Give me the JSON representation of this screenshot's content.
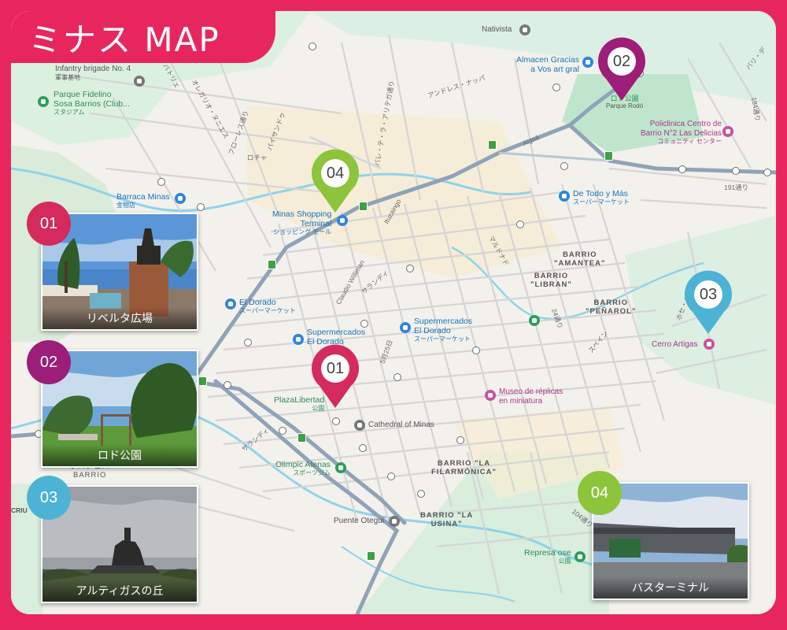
{
  "title": "ミナス MAP",
  "colors": {
    "brand": "#e8265e",
    "pin1": "#d42a5e",
    "pin2": "#9c1e78",
    "pin3": "#4cb3d4",
    "pin4": "#8cc43c"
  },
  "pins": [
    {
      "num": "01"
    },
    {
      "num": "02"
    },
    {
      "num": "03"
    },
    {
      "num": "04"
    }
  ],
  "photos": [
    {
      "num": "01",
      "caption": "リベルタ広場"
    },
    {
      "num": "02",
      "caption": "ロド公園"
    },
    {
      "num": "03",
      "caption": "アルティガスの丘"
    },
    {
      "num": "04",
      "caption": "バスターミナル"
    }
  ],
  "map_labels": {
    "nativista": "Nativista",
    "almacen": "Almacen Gracias",
    "almacen2": "a Vos art gral",
    "infantry": "Infantry brigade No. 4",
    "infantry_sub": "軍事基地",
    "parque_fidelino": "Parque Fidelino",
    "parque_fidelino2": "Sosa Barrios (Club...",
    "parque_fidelino_sub": "スタジアム",
    "parque_rodo": "ロド公園",
    "parque_rodo_sub": "Parque Rodó",
    "policlinica": "Policlinica Centro de",
    "policlinica2": "Barrio N°2 Las Delicias",
    "policlinica_sub": "コミュニティ センター",
    "barraca": "Barraca Minas",
    "barraca_sub": "金物店",
    "minas_shopping": "Minas Shopping",
    "minas_shopping2": "Terminal",
    "minas_shopping_sub": "ショッピング モール",
    "de_todo": "De Todo y Más",
    "de_todo_sub": "スーパーマーケット",
    "el_dorado": "El Dorado",
    "el_dorado_sub": "スーパーマーケット",
    "super_eldorado": "Supermercados",
    "super_eldorado2": "El Dorado",
    "super_eldorado3": "Supermercados",
    "super_eldorado4": "El Dorado",
    "super_eldorado_sub": "スーパーマーケット",
    "plaza": "PlazaLibertad",
    "plaza_sub": "公園",
    "cathedral": "Cathedral of Minas",
    "museo": "Museo de réplicas",
    "museo2": "en miniatura",
    "olimpic": "Olimpic Atenas",
    "olimpic_sub": "スポーツジム",
    "cerro": "Cerro Artigas",
    "puente": "Puente Otegui",
    "represa": "Represa ose",
    "represa_sub": "公園",
    "b_amantea": "BARRIO",
    "b_amantea2": "\"AMANTEA\"",
    "b_libran": "BARRIO",
    "b_libran2": "\"LIBRAN\"",
    "b_penarol": "BARRIO",
    "b_penarol2": "\"PEÑAROL\"",
    "b_filarmonica": "BARRIO \"LA",
    "b_filarmonica2": "FILARMÓNICA\"",
    "b_usina": "BARRIO \"LA",
    "b_usina2": "USINA\"",
    "b_left": "ラバシェバ",
    "b_left2": "BARRIO",
    "st_andres": "アンドレス・ナッパ",
    "st_florencio": "フローレス通り",
    "st_olegario": "オレガリオ・ヌニエス",
    "st_batlle": "バトリェ",
    "st_rocha": "ロチャ",
    "st_paysandu": "パイサンドゥ",
    "st_artigas": "バレ・テ・ラ・アリテガ通り",
    "st_ituzaingo": "Ituzaingo",
    "st_maldonado": "マルドナド",
    "st_claudio": "Claudio Williman",
    "st_sarandi": "サランディ",
    "st_25mayo": "5月25日",
    "st_sarandi2": "サランディ",
    "st_191": "191通り",
    "st_184": "184通り",
    "st_24": "24通り",
    "st_espana": "スペイン",
    "st_jose": "ホセ・ペドロ",
    "st_104": "104通り",
    "st_barrio": "バリ・デ",
    "st_aiguá": "Aiguá",
    "st_crlu": "CRIU"
  }
}
